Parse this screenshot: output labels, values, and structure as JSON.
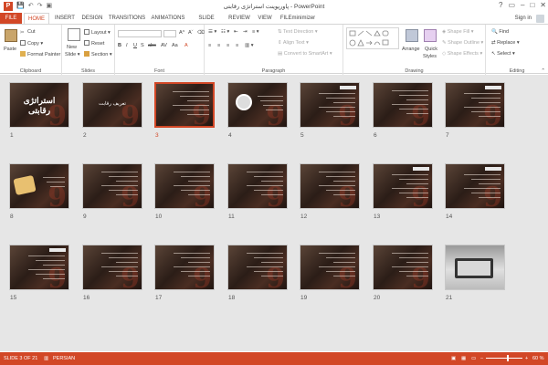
{
  "window": {
    "title": "پاورپوینت استراتژی رقابتی - PowerPoint",
    "app_icon": "P"
  },
  "qat_icons": [
    "save-icon",
    "undo-icon",
    "redo-icon",
    "start-slideshow-icon"
  ],
  "window_controls": [
    "?",
    "restore-ribbon",
    "–",
    "□",
    "✕"
  ],
  "tabs": [
    {
      "label": "FILE"
    },
    {
      "label": "HOME"
    },
    {
      "label": "INSERT"
    },
    {
      "label": "DESIGN"
    },
    {
      "label": "TRANSITIONS"
    },
    {
      "label": "ANIMATIONS"
    },
    {
      "label": "SLIDE SHOW"
    },
    {
      "label": "REVIEW"
    },
    {
      "label": "VIEW"
    },
    {
      "label": "FILEminimizer"
    }
  ],
  "signin": "Sign in",
  "ribbon": {
    "clipboard": {
      "paste": "Paste",
      "cut": "Cut",
      "copy": "Copy",
      "format_painter": "Format Painter",
      "label": "Clipboard"
    },
    "slides": {
      "new_slide_1": "New",
      "new_slide_2": "Slide",
      "layout": "Layout",
      "reset": "Reset",
      "section": "Section",
      "label": "Slides"
    },
    "font": {
      "label": "Font",
      "buttons": [
        "B",
        "I",
        "U",
        "S",
        "abc",
        "AV",
        "Aa",
        "A"
      ]
    },
    "paragraph": {
      "text_direction": "Text Direction",
      "align_text": "Align Text",
      "convert_smartart": "Convert to SmartArt",
      "label": "Paragraph"
    },
    "drawing": {
      "arrange": "Arrange",
      "quick_styles_1": "Quick",
      "quick_styles_2": "Styles",
      "shape_fill": "Shape Fill",
      "shape_outline": "Shape Outline",
      "shape_effects": "Shape Effects",
      "label": "Drawing"
    },
    "editing": {
      "find": "Find",
      "replace": "Replace",
      "select": "Select",
      "label": "Editing"
    }
  },
  "slides": [
    {
      "n": "1",
      "kind": "title",
      "text": "استراتژی رقابتی"
    },
    {
      "n": "2",
      "kind": "subtitle",
      "text": "تعریف رقابت"
    },
    {
      "n": "3",
      "kind": "text",
      "selected": true
    },
    {
      "n": "4",
      "kind": "icon"
    },
    {
      "n": "5",
      "kind": "header"
    },
    {
      "n": "6",
      "kind": "text"
    },
    {
      "n": "7",
      "kind": "header"
    },
    {
      "n": "8",
      "kind": "bulb"
    },
    {
      "n": "9",
      "kind": "text"
    },
    {
      "n": "10",
      "kind": "text"
    },
    {
      "n": "11",
      "kind": "text"
    },
    {
      "n": "12",
      "kind": "text"
    },
    {
      "n": "13",
      "kind": "header"
    },
    {
      "n": "14",
      "kind": "header"
    },
    {
      "n": "15",
      "kind": "header"
    },
    {
      "n": "16",
      "kind": "text"
    },
    {
      "n": "17",
      "kind": "text"
    },
    {
      "n": "18",
      "kind": "text"
    },
    {
      "n": "19",
      "kind": "text"
    },
    {
      "n": "20",
      "kind": "text"
    },
    {
      "n": "21",
      "kind": "photo"
    }
  ],
  "status": {
    "slide_of": "SLIDE 3 OF 21",
    "language": "PERSIAN",
    "zoom": "60 %",
    "zoom_fraction": 0.6
  },
  "colors": {
    "accent": "#d24726",
    "background": "#e6e6e6"
  }
}
